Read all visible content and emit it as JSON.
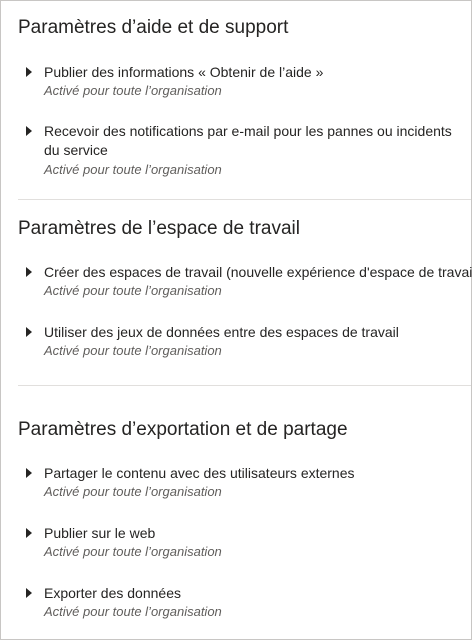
{
  "sections": [
    {
      "title": "Paramètres d’aide et de support",
      "items": [
        {
          "label": "Publier des informations « Obtenir de l’aide »",
          "status": "Activé pour toute l’organisation"
        },
        {
          "label": "Recevoir des notifications par e-mail pour les pannes ou incidents du service",
          "status": "Activé pour toute l’organisation"
        }
      ]
    },
    {
      "title": "Paramètres de l’espace de travail",
      "items": [
        {
          "label": "Créer des espaces de travail (nouvelle expérience d'espace de travail)",
          "status": "Activé pour toute l’organisation"
        },
        {
          "label": "Utiliser des jeux de données entre des espaces de travail",
          "status": "Activé pour toute l’organisation"
        }
      ]
    },
    {
      "title": "Paramètres d’exportation et de partage",
      "items": [
        {
          "label": "Partager le contenu avec des utilisateurs externes",
          "status": "Activé pour toute l’organisation"
        },
        {
          "label": "Publier sur le web",
          "status": "Activé pour toute l’organisation"
        },
        {
          "label": "Exporter des données",
          "status": "Activé pour toute l’organisation"
        }
      ]
    }
  ]
}
